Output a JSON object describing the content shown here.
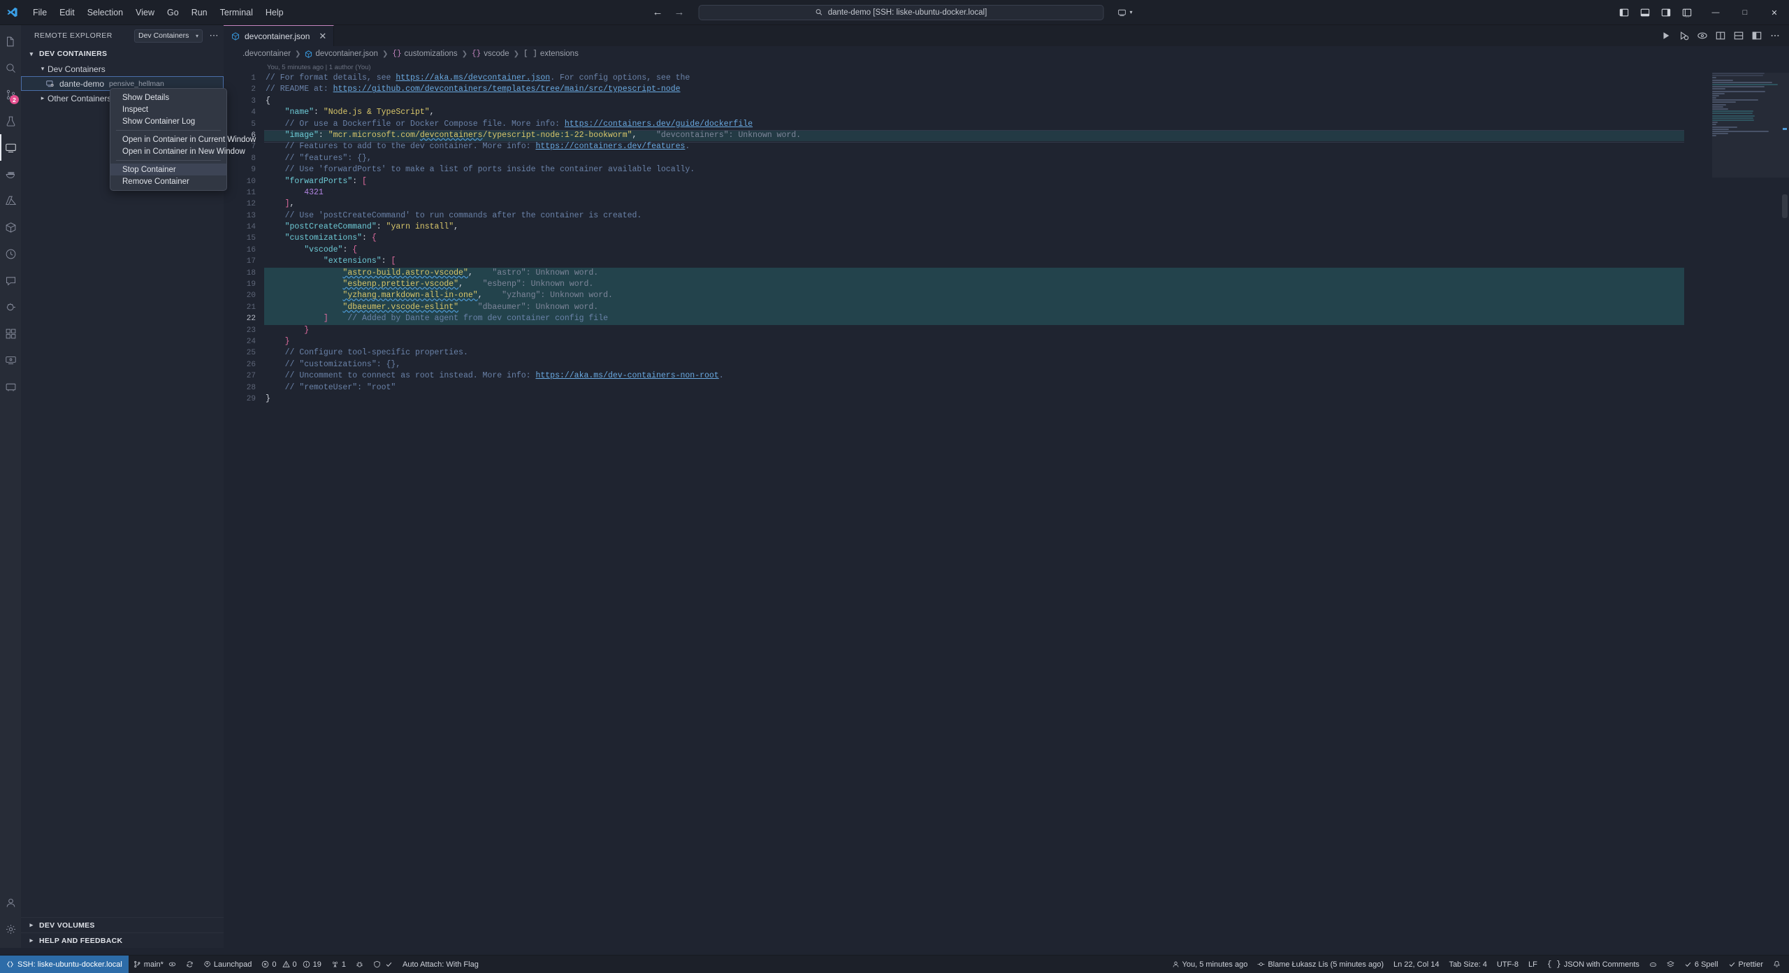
{
  "titlebar": {
    "logo_icon": "vscode-logo-icon",
    "menus": [
      "File",
      "Edit",
      "Selection",
      "View",
      "Go",
      "Run",
      "Terminal",
      "Help"
    ],
    "nav_back_icon": "arrow-left-icon",
    "nav_forward_icon": "arrow-right-icon",
    "command_center": {
      "search_icon": "search-icon",
      "text": "dante-demo [SSH: liske-ubuntu-docker.local]"
    },
    "remote_chip": {
      "icon": "remote-window-icon",
      "chevron": "chevron-down-icon"
    },
    "layout_icons": [
      "toggle-primary-sidebar-icon",
      "toggle-panel-icon",
      "toggle-secondary-sidebar-icon",
      "customize-layout-icon"
    ],
    "window_buttons": {
      "minimize": "—",
      "maximize": "□",
      "close": "✕"
    }
  },
  "activitybar": {
    "items": [
      {
        "name": "explorer",
        "icon": "files-icon",
        "active": false,
        "badge": ""
      },
      {
        "name": "search",
        "icon": "search-icon",
        "active": false,
        "badge": ""
      },
      {
        "name": "source-control",
        "icon": "source-control-icon",
        "active": false,
        "badge": "2"
      },
      {
        "name": "testing",
        "icon": "beaker-icon",
        "active": false,
        "badge": ""
      },
      {
        "name": "remote-explorer",
        "icon": "remote-explorer-icon",
        "active": true,
        "badge": ""
      },
      {
        "name": "docker",
        "icon": "docker-whale-icon",
        "active": false,
        "badge": ""
      },
      {
        "name": "azure",
        "icon": "azure-icon",
        "active": false,
        "badge": ""
      },
      {
        "name": "dev-containers",
        "icon": "dev-containers-icon",
        "active": false,
        "badge": ""
      },
      {
        "name": "timeline",
        "icon": "clock-icon",
        "active": false,
        "badge": ""
      },
      {
        "name": "copilot-chat",
        "icon": "comment-icon",
        "active": false,
        "badge": ""
      },
      {
        "name": "run-and-debug",
        "icon": "debug-icon",
        "active": false,
        "badge": ""
      },
      {
        "name": "extensions",
        "icon": "extensions-icon",
        "active": false,
        "badge": ""
      },
      {
        "name": "remote-tunnels",
        "icon": "remote-tunnel-icon",
        "active": false,
        "badge": ""
      },
      {
        "name": "ports",
        "icon": "ports-icon",
        "active": false,
        "badge": ""
      }
    ],
    "bottom_items": [
      {
        "name": "accounts",
        "icon": "account-icon"
      },
      {
        "name": "settings",
        "icon": "gear-icon"
      }
    ]
  },
  "sidebar": {
    "title": "REMOTE EXPLORER",
    "selector_value": "Dev Containers",
    "selector_chevron": "chevron-down-icon",
    "more_actions": "⋯",
    "section_title": "DEV CONTAINERS",
    "tree": [
      {
        "label": "Dev Containers",
        "sub": "",
        "expanded": true,
        "level": 1,
        "icon": "",
        "selected": false
      },
      {
        "label": "dante-demo",
        "sub": "pensive_hellman",
        "expanded": false,
        "level": 2,
        "icon": "container-running-icon",
        "selected": true
      },
      {
        "label": "Other Containers",
        "sub": "",
        "expanded": false,
        "level": 1,
        "icon": "",
        "selected": false
      }
    ],
    "bottom_sections": [
      "DEV VOLUMES",
      "HELP AND FEEDBACK"
    ]
  },
  "context_menu": {
    "items": [
      {
        "label": "Show Details",
        "highlighted": false,
        "separator_after": false
      },
      {
        "label": "Inspect",
        "highlighted": false,
        "separator_after": false
      },
      {
        "label": "Show Container Log",
        "highlighted": false,
        "separator_after": true
      },
      {
        "label": "Open in Container in Current Window",
        "highlighted": false,
        "separator_after": false
      },
      {
        "label": "Open in Container in New Window",
        "highlighted": false,
        "separator_after": true
      },
      {
        "label": "Stop Container",
        "highlighted": true,
        "separator_after": false
      },
      {
        "label": "Remove Container",
        "highlighted": false,
        "separator_after": false
      }
    ]
  },
  "editor": {
    "tab": {
      "label": "devcontainer.json",
      "icon": "json-file-icon",
      "close_icon": "close-icon"
    },
    "tab_actions": [
      "run-icon",
      "split-editor-icon",
      "preview-icon",
      "more-actions-icon"
    ],
    "breadcrumbs": [
      {
        "label": ".devcontainer",
        "icon": ""
      },
      {
        "label": "devcontainer.json",
        "icon": "json-file-icon"
      },
      {
        "label": "customizations",
        "icon": "braces"
      },
      {
        "label": "vscode",
        "icon": "braces"
      },
      {
        "label": "extensions",
        "icon": "brackets"
      }
    ],
    "blame": "You, 5 minutes ago | 1 author (You)",
    "lines": [
      {
        "n": 1,
        "tokens": [
          {
            "c": "com",
            "t": "// For format details, see "
          },
          {
            "c": "link",
            "t": "https://aka.ms/devcontainer.json"
          },
          {
            "c": "com",
            "t": ". For config options, see the"
          }
        ]
      },
      {
        "n": 2,
        "tokens": [
          {
            "c": "com",
            "t": "// README at: "
          },
          {
            "c": "link",
            "t": "https://github.com/devcontainers/templates/tree/main/src/typescript-node"
          }
        ]
      },
      {
        "n": 3,
        "tokens": [
          {
            "c": "pun",
            "t": "{"
          }
        ]
      },
      {
        "n": 4,
        "tokens": [
          {
            "c": "pun",
            "t": "    "
          },
          {
            "c": "key",
            "t": "\"name\""
          },
          {
            "c": "pun",
            "t": ": "
          },
          {
            "c": "str",
            "t": "\"Node.js & TypeScript\""
          },
          {
            "c": "pun",
            "t": ","
          }
        ]
      },
      {
        "n": 5,
        "tokens": [
          {
            "c": "pun",
            "t": "    "
          },
          {
            "c": "com",
            "t": "// Or use a Dockerfile or Docker Compose file. More info: "
          },
          {
            "c": "link",
            "t": "https://containers.dev/guide/dockerfile"
          }
        ]
      },
      {
        "n": 6,
        "highlight": true,
        "cursorline": true,
        "tokens": [
          {
            "c": "pun",
            "t": "    "
          },
          {
            "c": "key",
            "t": "\"image\""
          },
          {
            "c": "pun",
            "t": ": "
          },
          {
            "c": "str",
            "t": "\"mcr.microsoft.com/"
          },
          {
            "c": "str spell",
            "t": "devcontainers"
          },
          {
            "c": "str",
            "t": "/typescript-node:1-22-bookworm\""
          },
          {
            "c": "pun",
            "t": ","
          },
          {
            "c": "hint",
            "t": "    \"devcontainers\": Unknown word."
          }
        ]
      },
      {
        "n": 7,
        "tokens": [
          {
            "c": "pun",
            "t": "    "
          },
          {
            "c": "com",
            "t": "// Features to add to the dev container. More info: "
          },
          {
            "c": "link",
            "t": "https://containers.dev/features"
          },
          {
            "c": "com",
            "t": "."
          }
        ]
      },
      {
        "n": 8,
        "tokens": [
          {
            "c": "pun",
            "t": "    "
          },
          {
            "c": "com",
            "t": "// \"features\": {},"
          }
        ]
      },
      {
        "n": 9,
        "tokens": [
          {
            "c": "pun",
            "t": "    "
          },
          {
            "c": "com",
            "t": "// Use 'forwardPorts' to make a list of ports inside the container available locally."
          }
        ]
      },
      {
        "n": 10,
        "tokens": [
          {
            "c": "pun",
            "t": "    "
          },
          {
            "c": "key",
            "t": "\"forwardPorts\""
          },
          {
            "c": "pun",
            "t": ": "
          },
          {
            "c": "brk",
            "t": "["
          }
        ]
      },
      {
        "n": 11,
        "tokens": [
          {
            "c": "pun",
            "t": "        "
          },
          {
            "c": "num",
            "t": "4321"
          }
        ]
      },
      {
        "n": 12,
        "tokens": [
          {
            "c": "pun",
            "t": "    "
          },
          {
            "c": "brk",
            "t": "]"
          },
          {
            "c": "pun",
            "t": ","
          }
        ]
      },
      {
        "n": 13,
        "tokens": [
          {
            "c": "pun",
            "t": "    "
          },
          {
            "c": "com",
            "t": "// Use 'postCreateCommand' to run commands after the container is created."
          }
        ]
      },
      {
        "n": 14,
        "tokens": [
          {
            "c": "pun",
            "t": "    "
          },
          {
            "c": "key",
            "t": "\"postCreateCommand\""
          },
          {
            "c": "pun",
            "t": ": "
          },
          {
            "c": "str",
            "t": "\"yarn install\""
          },
          {
            "c": "pun",
            "t": ","
          }
        ]
      },
      {
        "n": 15,
        "tokens": [
          {
            "c": "pun",
            "t": "    "
          },
          {
            "c": "key",
            "t": "\"customizations\""
          },
          {
            "c": "pun",
            "t": ": "
          },
          {
            "c": "brk",
            "t": "{"
          }
        ]
      },
      {
        "n": 16,
        "tokens": [
          {
            "c": "pun",
            "t": "        "
          },
          {
            "c": "key",
            "t": "\"vscode\""
          },
          {
            "c": "pun",
            "t": ": "
          },
          {
            "c": "brk",
            "t": "{"
          }
        ]
      },
      {
        "n": 17,
        "tokens": [
          {
            "c": "pun",
            "t": "            "
          },
          {
            "c": "key",
            "t": "\"extensions\""
          },
          {
            "c": "pun",
            "t": ": "
          },
          {
            "c": "brk",
            "t": "["
          }
        ]
      },
      {
        "n": 18,
        "selected": true,
        "tokens": [
          {
            "c": "pun",
            "t": "                "
          },
          {
            "c": "str spell",
            "t": "\"astro-build.astro-vscode\""
          },
          {
            "c": "pun",
            "t": ","
          },
          {
            "c": "hint",
            "t": "    \"astro\": Unknown word."
          }
        ]
      },
      {
        "n": 19,
        "selected": true,
        "tokens": [
          {
            "c": "pun",
            "t": "                "
          },
          {
            "c": "str spell",
            "t": "\"esbenp.prettier-vscode\""
          },
          {
            "c": "pun",
            "t": ","
          },
          {
            "c": "hint",
            "t": "    \"esbenp\": Unknown word."
          }
        ]
      },
      {
        "n": 20,
        "selected": true,
        "tokens": [
          {
            "c": "pun",
            "t": "                "
          },
          {
            "c": "str spell",
            "t": "\"yzhang.markdown-all-in-one\""
          },
          {
            "c": "pun",
            "t": ","
          },
          {
            "c": "hint",
            "t": "    \"yzhang\": Unknown word."
          }
        ]
      },
      {
        "n": 21,
        "selected": true,
        "tokens": [
          {
            "c": "pun",
            "t": "                "
          },
          {
            "c": "str spell",
            "t": "\"dbaeumer.vscode-eslint\""
          },
          {
            "c": "hint",
            "t": "    \"dbaeumer\": Unknown word."
          }
        ]
      },
      {
        "n": 22,
        "selected": true,
        "cursorline": true,
        "tokens": [
          {
            "c": "pun",
            "t": "            "
          },
          {
            "c": "brk",
            "t": "]"
          },
          {
            "c": "ghost",
            "t": "    // Added by Dante agent from dev container config file"
          }
        ]
      },
      {
        "n": 23,
        "tokens": [
          {
            "c": "pun",
            "t": "        "
          },
          {
            "c": "brk",
            "t": "}"
          }
        ]
      },
      {
        "n": 24,
        "tokens": [
          {
            "c": "pun",
            "t": "    "
          },
          {
            "c": "brk",
            "t": "}"
          }
        ]
      },
      {
        "n": 25,
        "tokens": [
          {
            "c": "pun",
            "t": "    "
          },
          {
            "c": "com",
            "t": "// Configure tool-specific properties."
          }
        ]
      },
      {
        "n": 26,
        "tokens": [
          {
            "c": "pun",
            "t": "    "
          },
          {
            "c": "com",
            "t": "// \"customizations\": {},"
          }
        ]
      },
      {
        "n": 27,
        "tokens": [
          {
            "c": "pun",
            "t": "    "
          },
          {
            "c": "com",
            "t": "// Uncomment to connect as root instead. More info: "
          },
          {
            "c": "link",
            "t": "https://aka.ms/dev-containers-non-root"
          },
          {
            "c": "com",
            "t": "."
          }
        ]
      },
      {
        "n": 28,
        "tokens": [
          {
            "c": "pun",
            "t": "    "
          },
          {
            "c": "com",
            "t": "// \"remoteUser\": \"root\""
          }
        ]
      },
      {
        "n": 29,
        "tokens": [
          {
            "c": "pun",
            "t": "}"
          }
        ]
      }
    ]
  },
  "statusbar": {
    "remote": {
      "icon": "remote-indicator-icon",
      "label": "SSH: liske-ubuntu-docker.local"
    },
    "left_items": [
      {
        "icon": "source-control-icon",
        "label": "main*",
        "extra": "sync-icon"
      },
      {
        "icon": "sync-icon",
        "label": ""
      },
      {
        "icon": "rocket-icon",
        "label": "Launchpad"
      },
      {
        "icon": "error-icon",
        "label": "0",
        "label2": "0",
        "label3": "19",
        "composite": "0 ⚠ 0 ⓘ 19"
      },
      {
        "icon": "radio-tower-icon",
        "label": "1"
      },
      {
        "icon": "bug-icon",
        "label": ""
      },
      {
        "icon": "shield-check-icon",
        "label": ""
      },
      {
        "label": "Auto Attach: With Flag"
      }
    ],
    "errors": "0",
    "warnings": "0",
    "infos": "19",
    "ports": "1",
    "auto_attach": "Auto Attach: With Flag",
    "right_items": [
      {
        "icon": "account-icon",
        "label": "You, 5 minutes ago"
      },
      {
        "icon": "git-commit-icon",
        "label": "Blame Łukasz Lis (5 minutes ago)"
      },
      {
        "label": "Ln 22, Col 14"
      },
      {
        "label": "Tab Size: 4"
      },
      {
        "label": "UTF-8"
      },
      {
        "label": "LF"
      },
      {
        "icon": "braces-icon",
        "label": "JSON with Comments"
      },
      {
        "icon": "copilot-icon",
        "label": ""
      },
      {
        "icon": "layers-icon",
        "label": ""
      },
      {
        "icon": "check-icon",
        "label": "6 Spell"
      },
      {
        "icon": "check-icon",
        "label": "Prettier"
      },
      {
        "icon": "bell-icon",
        "label": ""
      }
    ]
  }
}
